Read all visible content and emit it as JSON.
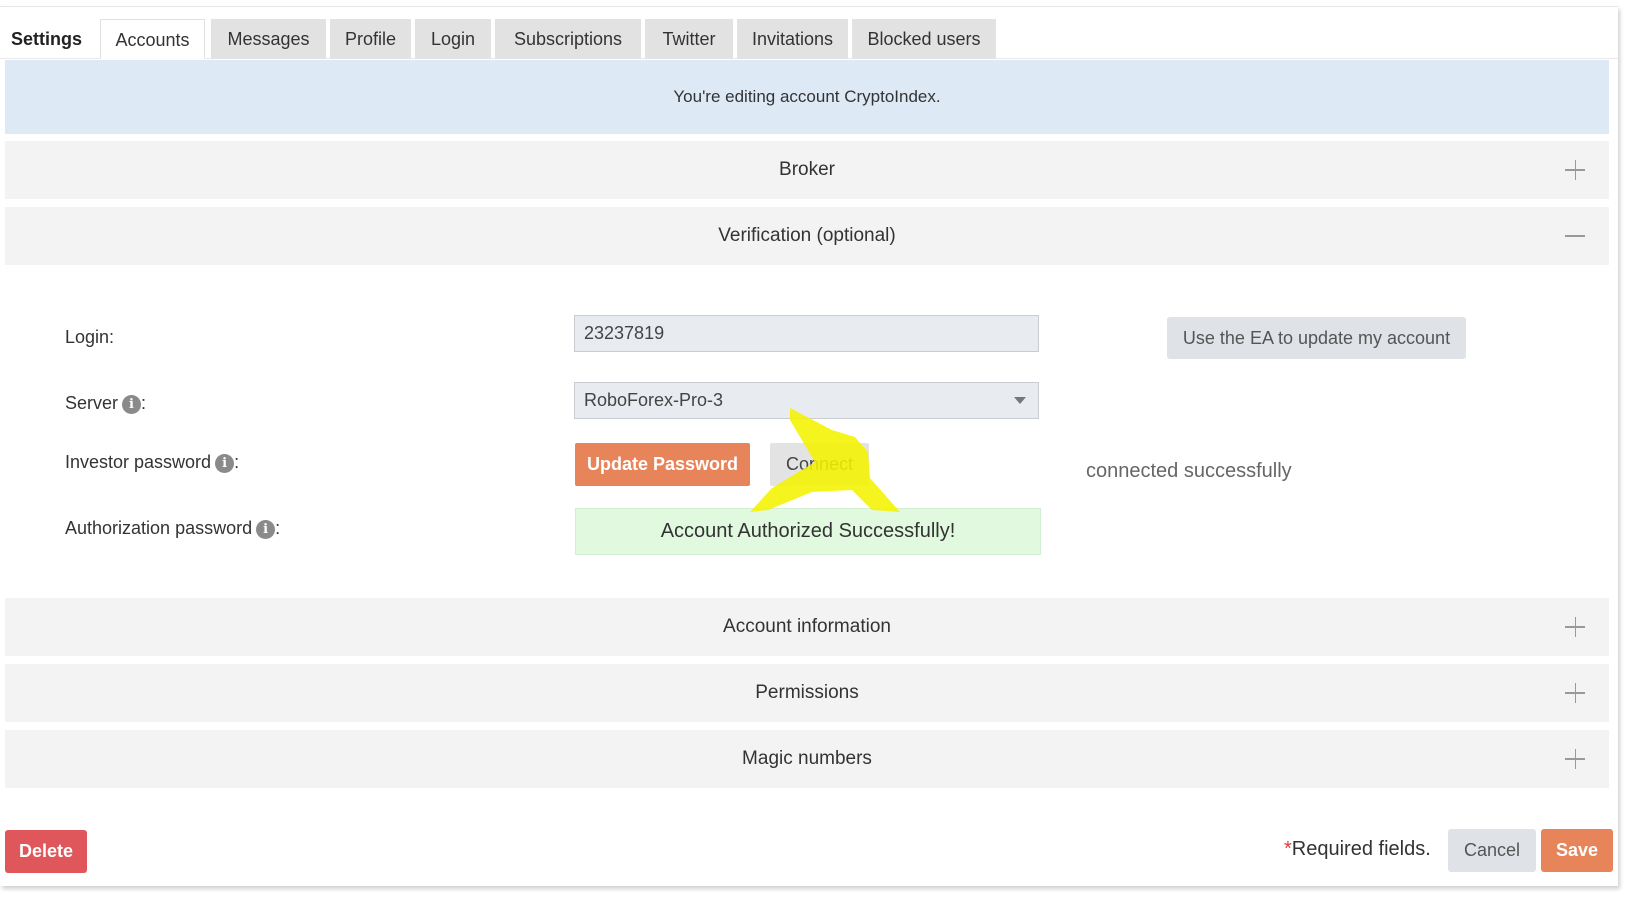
{
  "tabs": [
    {
      "label": "Settings",
      "style": "plain"
    },
    {
      "label": "Accounts",
      "style": "active"
    },
    {
      "label": "Messages",
      "style": "gray"
    },
    {
      "label": "Profile",
      "style": "gray"
    },
    {
      "label": "Login",
      "style": "gray"
    },
    {
      "label": "Subscriptions",
      "style": "gray"
    },
    {
      "label": "Twitter",
      "style": "gray"
    },
    {
      "label": "Invitations",
      "style": "gray"
    },
    {
      "label": "Blocked users",
      "style": "gray"
    }
  ],
  "banner": {
    "text": "You're editing account CryptoIndex."
  },
  "sections": {
    "broker": {
      "title": "Broker",
      "state": "collapsed"
    },
    "verification": {
      "title": "Verification (optional)",
      "state": "expanded"
    },
    "account_information": {
      "title": "Account information",
      "state": "collapsed"
    },
    "permissions": {
      "title": "Permissions",
      "state": "collapsed"
    },
    "magic_numbers": {
      "title": "Magic numbers",
      "state": "collapsed"
    }
  },
  "form": {
    "login_label": "Login:",
    "login_value": "23237819",
    "server_label": "Server",
    "server_value": "RoboForex-Pro-3",
    "investor_password_label": "Investor password",
    "authorization_password_label": "Authorization password",
    "colon": ":",
    "ea_button": "Use the EA to update my account",
    "update_password_button": "Update Password",
    "connect_button": "Connect",
    "connection_status": "connected successfully",
    "authorization_message": "Account Authorized Successfully!"
  },
  "footer": {
    "delete_button": "Delete",
    "required_star": "*",
    "required_text": "Required fields.",
    "cancel_button": "Cancel",
    "save_button": "Save"
  },
  "colors": {
    "accent_orange": "#e8845a",
    "danger_red": "#e0575b",
    "banner_blue": "#dee9f6",
    "success_green": "#e0f9df",
    "highlight_yellow": "#f5f200"
  },
  "icons": {
    "info": "info-circle-icon",
    "expand": "plus-icon",
    "collapse": "minus-icon",
    "dropdown": "chevron-down-icon"
  }
}
